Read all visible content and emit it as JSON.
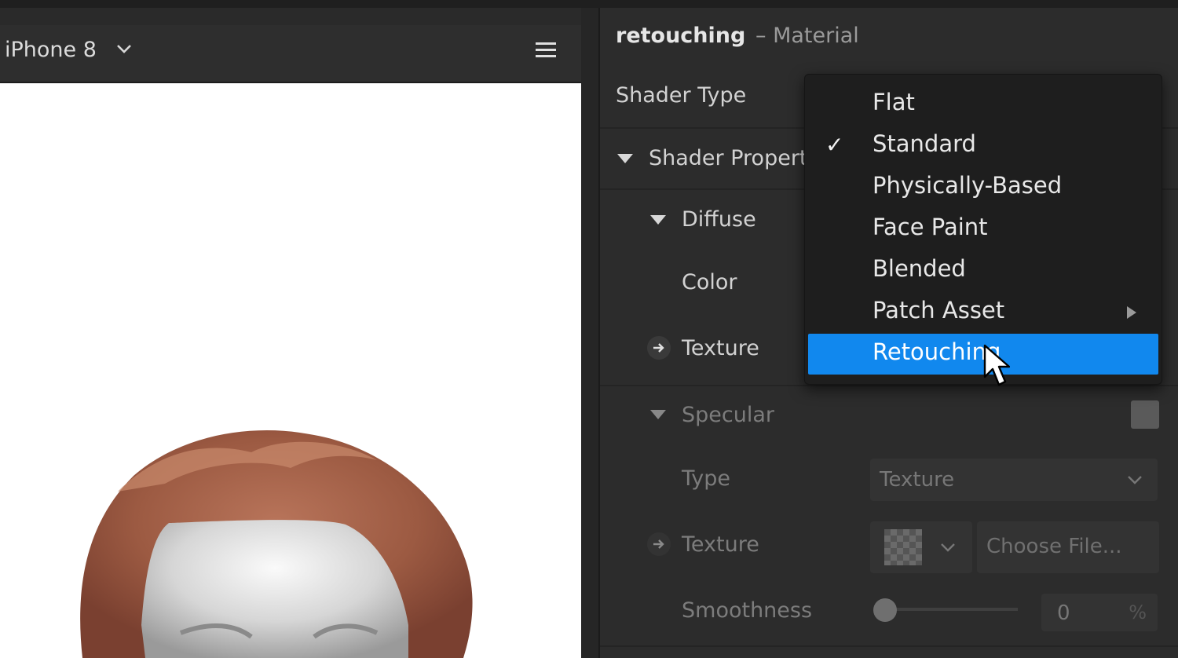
{
  "viewport": {
    "device": "iPhone 8"
  },
  "inspector": {
    "object_name": "retouching",
    "object_kind": "– Material",
    "shader_type_label": "Shader Type",
    "shader_properties_label": "Shader Properti",
    "diffuse": {
      "label": "Diffuse",
      "color_label": "Color",
      "texture_label": "Texture"
    },
    "specular": {
      "label": "Specular",
      "type_label": "Type",
      "type_value": "Texture",
      "texture_label": "Texture",
      "choose_file": "Choose File...",
      "smoothness_label": "Smoothness",
      "smoothness_value": "0",
      "smoothness_unit": "%"
    }
  },
  "shader_menu": {
    "items": [
      {
        "label": "Flat"
      },
      {
        "label": "Standard",
        "checked": true
      },
      {
        "label": "Physically-Based"
      },
      {
        "label": "Face Paint"
      },
      {
        "label": "Blended"
      },
      {
        "label": "Patch Asset",
        "submenu": true
      },
      {
        "label": "Retouching",
        "highlighted": true
      }
    ],
    "highlight_color": "#1188ee"
  },
  "icons": [
    "chevron-down-icon",
    "hamburger-menu-icon",
    "disclosure-triangle-icon",
    "arrow-right-icon",
    "checkmark-icon",
    "submenu-arrow-icon",
    "mouse-cursor-icon"
  ]
}
